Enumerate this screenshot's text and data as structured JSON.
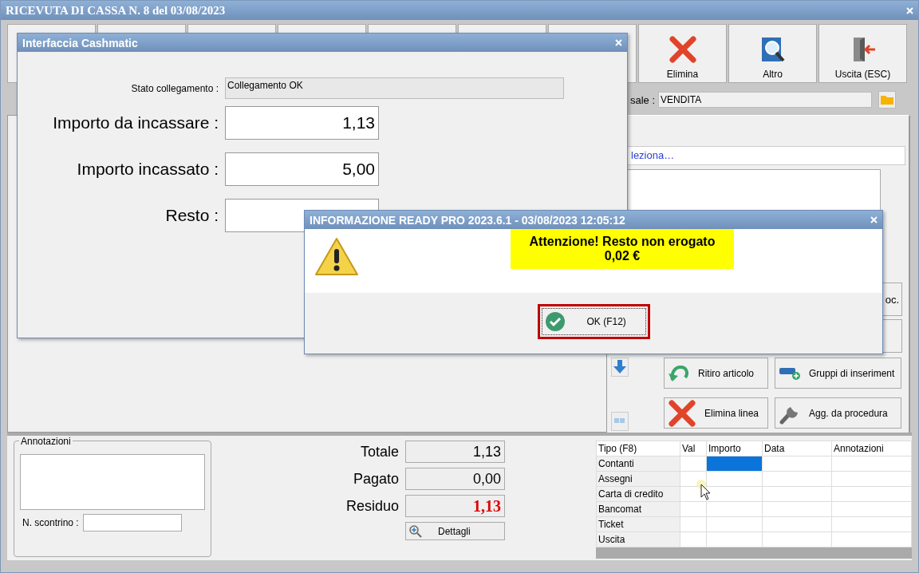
{
  "window": {
    "title": "RICEVUTA DI CASSA N. 8 del 03/08/2023"
  },
  "toolbar": [
    {
      "label": "Elimina",
      "kind": "delete"
    },
    {
      "label": "Altro",
      "kind": "search"
    },
    {
      "label": "Uscita (ESC)",
      "kind": "exit"
    }
  ],
  "causale": {
    "label": "sale :",
    "value": "VENDITA"
  },
  "select_prompt": "leziona…",
  "side_buttons": [
    {
      "label": "oc."
    }
  ],
  "action_buttons": [
    {
      "label": "Ritiro articolo",
      "kind": "undo"
    },
    {
      "label": "Gruppi di inseriment",
      "kind": "group"
    },
    {
      "label": "Elimina linea",
      "kind": "delete"
    },
    {
      "label": "Agg. da procedura",
      "kind": "wrench"
    }
  ],
  "annotations": {
    "label": "Annotazioni",
    "receipt_label": "N. scontrino :"
  },
  "totals": [
    {
      "label": "Totale",
      "value": "1,13",
      "kind": "normal"
    },
    {
      "label": "Pagato",
      "value": "0,00",
      "kind": "normal"
    },
    {
      "label": "Residuo",
      "value": "1,13",
      "kind": "due"
    }
  ],
  "details_button": "Dettagli",
  "payments": {
    "columns": [
      "Tipo (F8)",
      "Val",
      "Importo",
      "Data",
      "Annotazioni"
    ],
    "rows": [
      {
        "type": "Contanti",
        "selected": true
      },
      {
        "type": "Assegni",
        "selected": false
      },
      {
        "type": "Carta di credito",
        "selected": false
      },
      {
        "type": "Bancomat",
        "selected": false
      },
      {
        "type": "Ticket",
        "selected": false
      },
      {
        "type": "Uscita",
        "selected": false
      }
    ]
  },
  "cashmatic": {
    "title": "Interfaccia Cashmatic",
    "status_label": "Stato collegamento :",
    "status_value": "Collegamento OK",
    "fields": [
      {
        "label": "Importo da incassare :",
        "value": "1,13"
      },
      {
        "label": "Importo incassato :",
        "value": "5,00"
      },
      {
        "label": "Resto :"
      }
    ]
  },
  "info_dialog": {
    "title": "INFORMAZIONE READY PRO 2023.6.1 - 03/08/2023 12:05:12",
    "message": "Attenzione! Resto non erogato",
    "amount": "0,02 €",
    "ok_button": "OK (F12)"
  }
}
